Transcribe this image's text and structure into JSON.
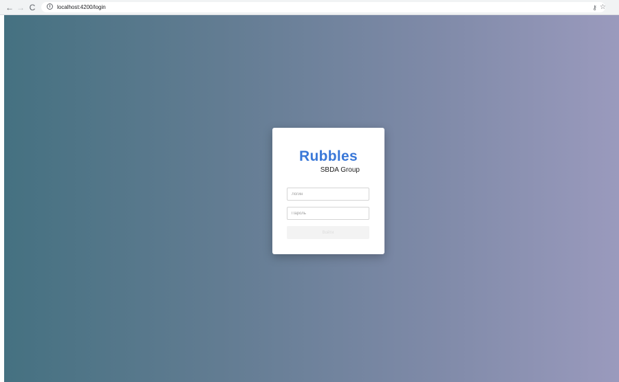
{
  "browser": {
    "back_icon": "←",
    "forward_icon": "→",
    "reload_icon": "C",
    "info_icon": "i",
    "url": "localhost:4200/login",
    "key_icon": "⚷",
    "star_icon": "☆"
  },
  "login": {
    "logo_main": "Rubbles",
    "logo_sub": "SBDA Group",
    "login_placeholder": "Логин",
    "password_placeholder": "Пароль",
    "submit_label": "Войти",
    "submit_disabled": true
  },
  "colors": {
    "brand": "#3a78d8",
    "gradient_start": "#457181",
    "gradient_end": "#9a9abd"
  }
}
